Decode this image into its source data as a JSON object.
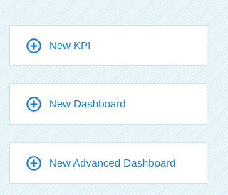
{
  "colors": {
    "accent": "#1c7bc8",
    "card_background": "#ffffff",
    "card_border": "#cfe3ee",
    "page_background": "#e4f3fb"
  },
  "actions": [
    {
      "icon": "plus-circle-icon",
      "label": "New KPI"
    },
    {
      "icon": "plus-circle-icon",
      "label": "New Dashboard"
    },
    {
      "icon": "plus-circle-icon",
      "label": "New Advanced Dashboard"
    }
  ]
}
